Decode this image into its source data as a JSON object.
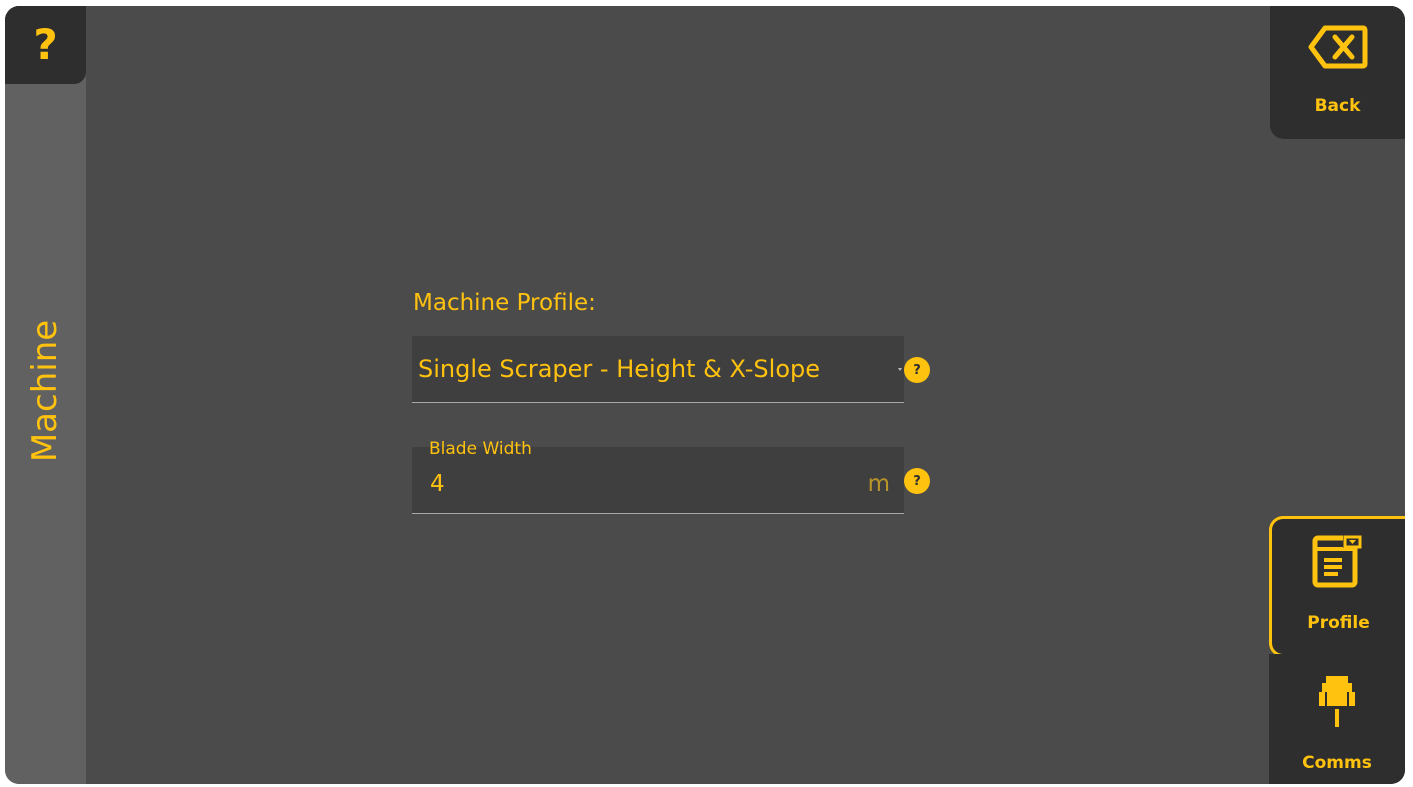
{
  "help_corner": {
    "glyph": "?"
  },
  "rail": {
    "title": "Machine"
  },
  "back_button": {
    "label": "Back",
    "icon": "backspace-x-icon"
  },
  "tabs": [
    {
      "label": "Profile",
      "icon": "profile-form-icon",
      "selected": true
    },
    {
      "label": "Comms",
      "icon": "connector-plug-icon",
      "selected": false
    }
  ],
  "form": {
    "profile_label": "Machine Profile:",
    "profile_value": "Single Scraper - Height & X-Slope",
    "blade_width_label": "Blade Width",
    "blade_width_value": "4",
    "blade_width_unit": "m",
    "help_glyph": "?"
  },
  "colors": {
    "accent": "#ffc20e",
    "background": "#4b4b4b",
    "rail": "#616161",
    "button_bg": "#2e2e2e"
  }
}
